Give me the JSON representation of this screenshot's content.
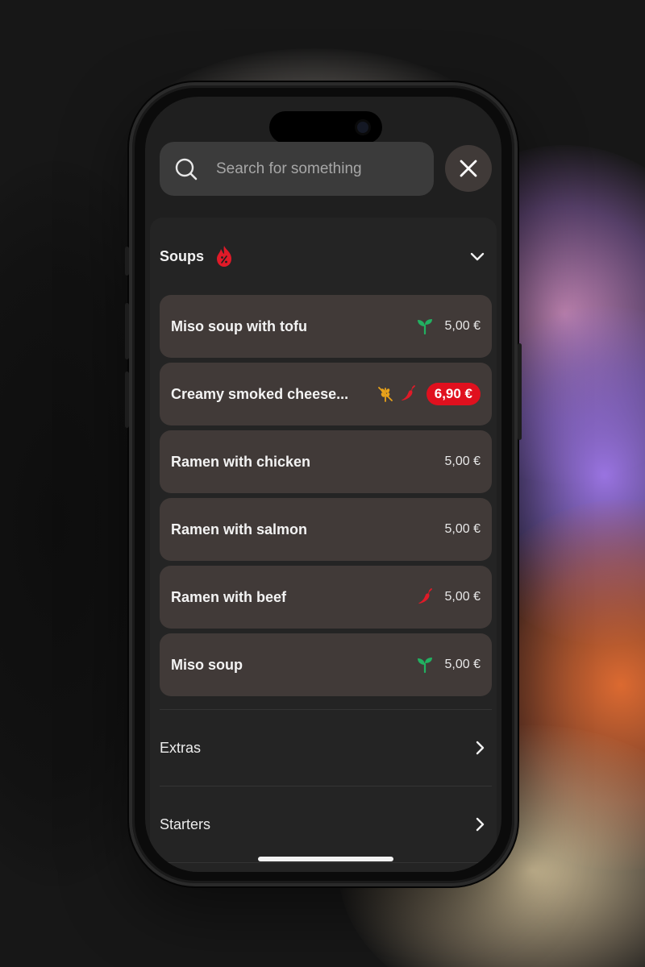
{
  "search": {
    "placeholder": "Search for something",
    "value": ""
  },
  "section": {
    "title": "Soups",
    "icon": "fire-icon",
    "state": "expanded"
  },
  "items": [
    {
      "name": "Miso soup with tofu",
      "price": "5,00 €",
      "tags": [
        "vegan"
      ],
      "highlight": false
    },
    {
      "name": "Creamy smoked cheese...",
      "price": "6,90 €",
      "tags": [
        "gluten-free",
        "spicy"
      ],
      "highlight": true
    },
    {
      "name": "Ramen with chicken",
      "price": "5,00 €",
      "tags": [],
      "highlight": false
    },
    {
      "name": "Ramen with salmon",
      "price": "5,00 €",
      "tags": [],
      "highlight": false
    },
    {
      "name": "Ramen with beef",
      "price": "5,00 €",
      "tags": [
        "spicy"
      ],
      "highlight": false
    },
    {
      "name": "Miso soup",
      "price": "5,00 €",
      "tags": [
        "vegan"
      ],
      "highlight": false
    }
  ],
  "categories": [
    {
      "label": "Extras"
    },
    {
      "label": "Starters"
    }
  ],
  "colors": {
    "accent_red": "#e0101e",
    "vegan_green": "#22b061",
    "gluten_amber": "#e9a21a",
    "spicy_red": "#e01a28",
    "card_bg": "#413a38",
    "panel_bg": "#242424"
  }
}
